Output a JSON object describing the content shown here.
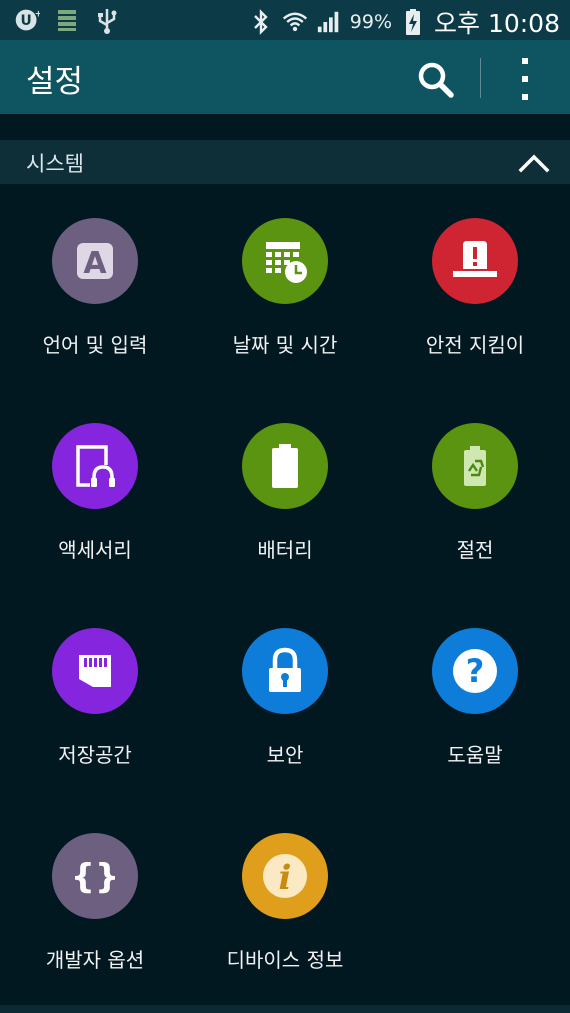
{
  "status_bar": {
    "icons_left": [
      "u-plus-icon",
      "sim-card-icon",
      "usb-icon"
    ],
    "icons_right": [
      "bluetooth-icon",
      "wifi-icon",
      "signal-icon"
    ],
    "battery": "99%",
    "battery_icon": "battery-charging-icon",
    "time": "오후 10:08"
  },
  "app_bar": {
    "title": "설정",
    "search_icon": "search-icon",
    "more_icon": "more-vert-icon"
  },
  "section": {
    "title": "시스템",
    "collapse_icon": "chevron-up-icon"
  },
  "items": [
    {
      "label": "언어 및 입력",
      "icon": "language-icon",
      "color": "#6c5f80"
    },
    {
      "label": "날짜 및 시간",
      "icon": "calendar-clock-icon",
      "color": "#5a9411"
    },
    {
      "label": "안전 지킴이",
      "icon": "emergency-icon",
      "color": "#cf2431"
    },
    {
      "label": "액세서리",
      "icon": "accessory-icon",
      "color": "#8525de"
    },
    {
      "label": "배터리",
      "icon": "battery-icon",
      "color": "#5a9411"
    },
    {
      "label": "절전",
      "icon": "power-saving-icon",
      "color": "#5a9411"
    },
    {
      "label": "저장공간",
      "icon": "storage-icon",
      "color": "#8525de"
    },
    {
      "label": "보안",
      "icon": "lock-icon",
      "color": "#0d7dd9"
    },
    {
      "label": "도움말",
      "icon": "help-icon",
      "color": "#0d7dd9"
    },
    {
      "label": "개발자 옵션",
      "icon": "developer-icon",
      "color": "#6c5f80"
    },
    {
      "label": "디바이스 정보",
      "icon": "info-icon",
      "color": "#df9e1c"
    }
  ]
}
